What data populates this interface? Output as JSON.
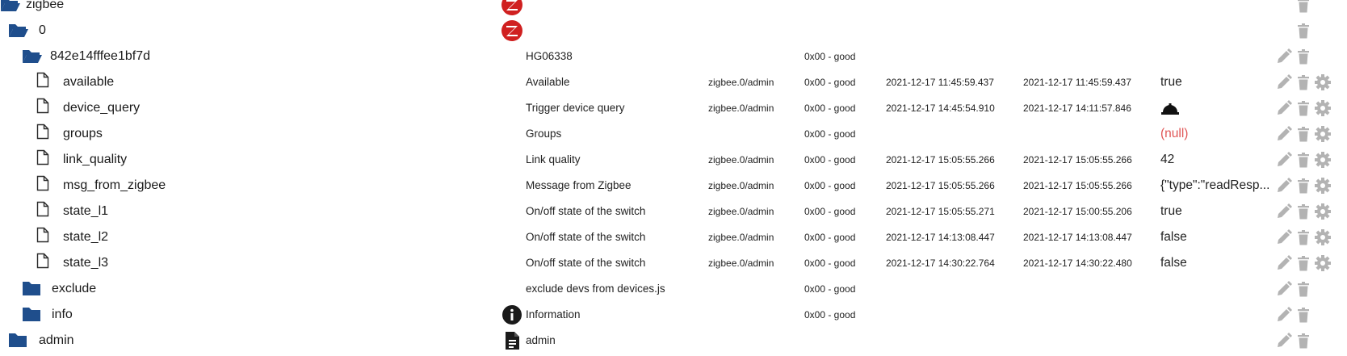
{
  "colors": {
    "folder": "#1f4e8c",
    "file_outline": "#2a2a2a",
    "action_icon": "#b3b3b3",
    "null_value": "#e05555",
    "zigbee_badge": "#d02020"
  },
  "rows": [
    {
      "name": "zigbee",
      "icon": "folder-open",
      "role_icon": "zigbee-logo",
      "desc": "",
      "from": "",
      "quality": "",
      "ts": "",
      "lc": "",
      "value": "",
      "edit": false,
      "config": false
    },
    {
      "name": "0",
      "icon": "folder-open",
      "role_icon": "zigbee-logo",
      "desc": "",
      "from": "",
      "quality": "",
      "ts": "",
      "lc": "",
      "value": "",
      "edit": false,
      "config": false
    },
    {
      "name": "842e14fffee1bf7d",
      "icon": "folder-open",
      "role_icon": "",
      "desc": "HG06338",
      "from": "",
      "quality": "0x00 - good",
      "ts": "",
      "lc": "",
      "value": "",
      "edit": true,
      "config": false
    },
    {
      "name": "available",
      "icon": "file",
      "role_icon": "",
      "desc": "Available",
      "from": "zigbee.0/admin",
      "quality": "0x00 - good",
      "ts": "2021-12-17 11:45:59.437",
      "lc": "2021-12-17 11:45:59.437",
      "value": "true",
      "edit": true,
      "config": true
    },
    {
      "name": "device_query",
      "icon": "file",
      "role_icon": "",
      "desc": "Trigger device query",
      "from": "zigbee.0/admin",
      "quality": "0x00 - good",
      "ts": "2021-12-17 14:45:54.910",
      "lc": "2021-12-17 14:11:57.846",
      "value": "",
      "value_icon": "bell-button-icon",
      "edit": true,
      "config": true
    },
    {
      "name": "groups",
      "icon": "file",
      "role_icon": "",
      "desc": "Groups",
      "from": "",
      "quality": "0x00 - good",
      "ts": "",
      "lc": "",
      "value": "(null)",
      "null": true,
      "edit": true,
      "config": true
    },
    {
      "name": "link_quality",
      "icon": "file",
      "role_icon": "",
      "desc": "Link quality",
      "from": "zigbee.0/admin",
      "quality": "0x00 - good",
      "ts": "2021-12-17 15:05:55.266",
      "lc": "2021-12-17 15:05:55.266",
      "value": "42",
      "edit": true,
      "config": true
    },
    {
      "name": "msg_from_zigbee",
      "icon": "file",
      "role_icon": "",
      "desc": "Message from Zigbee",
      "from": "zigbee.0/admin",
      "quality": "0x00 - good",
      "ts": "2021-12-17 15:05:55.266",
      "lc": "2021-12-17 15:05:55.266",
      "value": "{\"type\":\"readResp...",
      "edit": true,
      "config": true
    },
    {
      "name": "state_l1",
      "icon": "file",
      "role_icon": "",
      "desc": "On/off state of the switch",
      "from": "zigbee.0/admin",
      "quality": "0x00 - good",
      "ts": "2021-12-17 15:05:55.271",
      "lc": "2021-12-17 15:00:55.206",
      "value": "true",
      "edit": true,
      "config": true
    },
    {
      "name": "state_l2",
      "icon": "file",
      "role_icon": "",
      "desc": "On/off state of the switch",
      "from": "zigbee.0/admin",
      "quality": "0x00 - good",
      "ts": "2021-12-17 14:13:08.447",
      "lc": "2021-12-17 14:13:08.447",
      "value": "false",
      "edit": true,
      "config": true
    },
    {
      "name": "state_l3",
      "icon": "file",
      "role_icon": "",
      "desc": "On/off state of the switch",
      "from": "zigbee.0/admin",
      "quality": "0x00 - good",
      "ts": "2021-12-17 14:30:22.764",
      "lc": "2021-12-17 14:30:22.480",
      "value": "false",
      "edit": true,
      "config": true
    },
    {
      "name": "exclude",
      "icon": "folder-closed",
      "role_icon": "",
      "desc": "exclude devs from devices.js",
      "from": "",
      "quality": "0x00 - good",
      "ts": "",
      "lc": "",
      "value": "",
      "edit": true,
      "config": false
    },
    {
      "name": "info",
      "icon": "folder-closed",
      "role_icon": "info-icon",
      "desc": "Information",
      "from": "",
      "quality": "0x00 - good",
      "ts": "",
      "lc": "",
      "value": "",
      "edit": true,
      "config": false
    },
    {
      "name": "admin",
      "icon": "folder-closed",
      "role_icon": "document-icon",
      "desc": "admin",
      "from": "",
      "quality": "",
      "ts": "",
      "lc": "",
      "value": "",
      "edit": true,
      "config": false
    }
  ]
}
